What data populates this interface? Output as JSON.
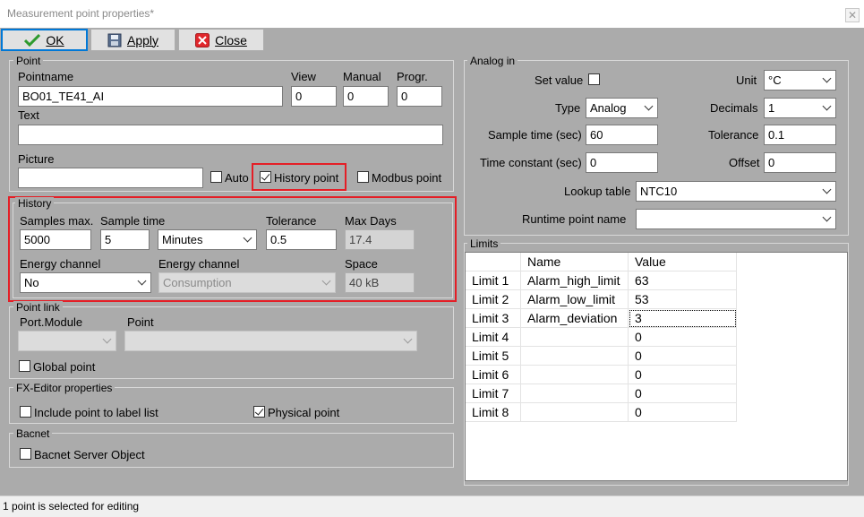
{
  "window": {
    "title": "Measurement point properties*",
    "close_glyph": "✕"
  },
  "toolbar": {
    "ok_label": "OK",
    "apply_label": "Apply",
    "close_label": "Close"
  },
  "point": {
    "group_label": "Point",
    "pointname_label": "Pointname",
    "pointname_value": "BO01_TE41_AI",
    "view_label": "View",
    "view_value": "0",
    "manual_label": "Manual",
    "manual_value": "0",
    "progr_label": "Progr.",
    "progr_value": "0",
    "text_label": "Text",
    "text_value": "",
    "picture_label": "Picture",
    "picture_value": "",
    "auto_label": "Auto",
    "auto_checked": false,
    "history_point_label": "History point",
    "history_point_checked": true,
    "modbus_point_label": "Modbus point",
    "modbus_point_checked": false
  },
  "history": {
    "group_label": "History",
    "samples_max_label": "Samples max.",
    "samples_max_value": "5000",
    "sample_time_label": "Sample time",
    "sample_time_value": "5",
    "sample_time_unit": "Minutes",
    "tolerance_label": "Tolerance",
    "tolerance_value": "0.5",
    "max_days_label": "Max Days",
    "max_days_value": "17.4",
    "energy_channel_label": "Energy channel",
    "energy_channel_value": "No",
    "energy_channel2_label": "Energy channel",
    "energy_channel2_value": "Consumption",
    "space_label": "Space",
    "space_value": "40 kB"
  },
  "point_link": {
    "group_label": "Point link",
    "port_module_label": "Port.Module",
    "port_module_value": "",
    "point_label": "Point",
    "point_value": "",
    "global_point_label": "Global point",
    "global_point_checked": false
  },
  "fx_editor": {
    "group_label": "FX-Editor properties",
    "include_label": "Include point to label list",
    "include_checked": false,
    "physical_label": "Physical point",
    "physical_checked": true
  },
  "bacnet": {
    "group_label": "Bacnet",
    "server_object_label": "Bacnet Server Object",
    "server_object_checked": false
  },
  "analog_in": {
    "group_label": "Analog in",
    "set_value_label": "Set value",
    "set_value_checked": false,
    "unit_label": "Unit",
    "unit_value": "°C",
    "type_label": "Type",
    "type_value": "Analog",
    "decimals_label": "Decimals",
    "decimals_value": "1",
    "sample_time_label": "Sample time (sec)",
    "sample_time_value": "60",
    "tolerance_label": "Tolerance",
    "tolerance_value": "0.1",
    "time_constant_label": "Time constant (sec)",
    "time_constant_value": "0",
    "offset_label": "Offset",
    "offset_value": "0",
    "lookup_table_label": "Lookup table",
    "lookup_table_value": "NTC10",
    "runtime_point_label": "Runtime point name",
    "runtime_point_value": ""
  },
  "limits": {
    "group_label": "Limits",
    "headers": [
      "Name",
      "Value"
    ],
    "rows": [
      {
        "label": "Limit 1",
        "name": "Alarm_high_limit",
        "value": "63"
      },
      {
        "label": "Limit 2",
        "name": "Alarm_low_limit",
        "value": "53"
      },
      {
        "label": "Limit 3",
        "name": "Alarm_deviation",
        "value": "3"
      },
      {
        "label": "Limit 4",
        "name": "",
        "value": "0"
      },
      {
        "label": "Limit 5",
        "name": "",
        "value": "0"
      },
      {
        "label": "Limit 6",
        "name": "",
        "value": "0"
      },
      {
        "label": "Limit 7",
        "name": "",
        "value": "0"
      },
      {
        "label": "Limit 8",
        "name": "",
        "value": "0"
      }
    ]
  },
  "status_text": "1 point is selected for editing",
  "colors": {
    "dialog_bg": "#ababab",
    "highlight": "#e41e26",
    "ok_border": "#0078d7",
    "check_green": "#2e9a2e",
    "close_red": "#e0262b"
  }
}
